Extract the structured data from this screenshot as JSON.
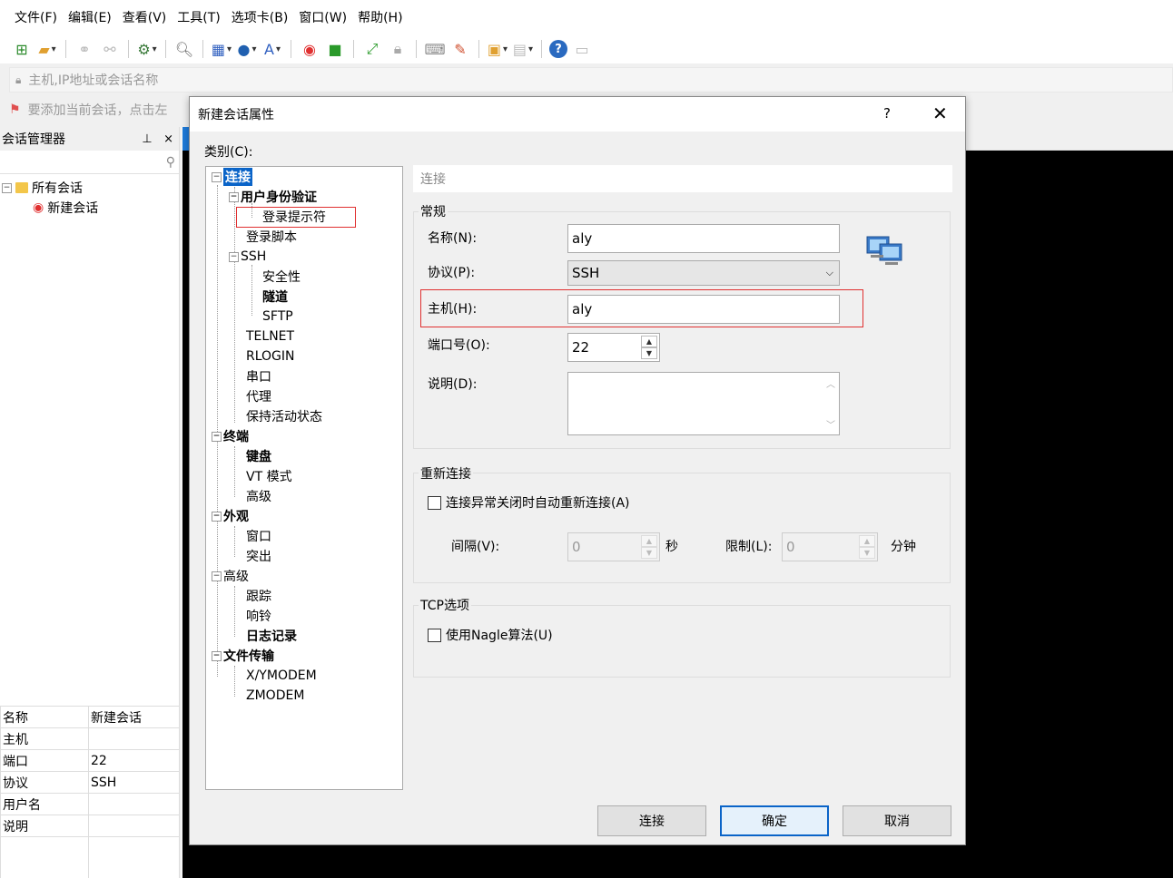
{
  "menu": [
    "文件(F)",
    "编辑(E)",
    "查看(V)",
    "工具(T)",
    "选项卡(B)",
    "窗口(W)",
    "帮助(H)"
  ],
  "address_placeholder": "主机,IP地址或会话名称",
  "hint_text": "要添加当前会话，点击左",
  "session_manager": {
    "title": "会话管理器",
    "pin": "ꟷ",
    "close": "×",
    "root": "所有会话",
    "child": "新建会话"
  },
  "props": [
    {
      "k": "名称",
      "v": "新建会话"
    },
    {
      "k": "主机",
      "v": ""
    },
    {
      "k": "端口",
      "v": "22"
    },
    {
      "k": "协议",
      "v": "SSH"
    },
    {
      "k": "用户名",
      "v": ""
    },
    {
      "k": "说明",
      "v": ""
    }
  ],
  "dialog": {
    "title": "新建会话属性",
    "help": "?",
    "close": "✕",
    "category_label": "类别(C):",
    "tree": {
      "conn": "连接",
      "auth": "用户身份验证",
      "login_prompt": "登录提示符",
      "login_script": "登录脚本",
      "ssh": "SSH",
      "security": "安全性",
      "tunnel": "隧道",
      "sftp": "SFTP",
      "telnet": "TELNET",
      "rlogin": "RLOGIN",
      "serial": "串口",
      "proxy": "代理",
      "keepalive": "保持活动状态",
      "terminal": "终端",
      "keyboard": "键盘",
      "vt": "VT 模式",
      "adv": "高级",
      "appearance": "外观",
      "window": "窗口",
      "highlight": "突出",
      "advanced": "高级",
      "trace": "跟踪",
      "bell": "响铃",
      "logging": "日志记录",
      "filetransfer": "文件传输",
      "xymodem": "X/YMODEM",
      "zmodem": "ZMODEM"
    },
    "section_head": "连接",
    "general": {
      "label": "常规",
      "name_label": "名称(N):",
      "name_value": "aly",
      "protocol_label": "协议(P):",
      "protocol_value": "SSH",
      "host_label": "主机(H):",
      "host_value": "aly",
      "port_label": "端口号(O):",
      "port_value": "22",
      "desc_label": "说明(D):"
    },
    "reconnect": {
      "label": "重新连接",
      "auto_label": "连接异常关闭时自动重新连接(A)",
      "interval_label": "间隔(V):",
      "interval_value": "0",
      "seconds": "秒",
      "limit_label": "限制(L):",
      "limit_value": "0",
      "minutes": "分钟"
    },
    "tcp": {
      "label": "TCP选项",
      "nagle_label": "使用Nagle算法(U)"
    },
    "buttons": {
      "connect": "连接",
      "ok": "确定",
      "cancel": "取消"
    }
  },
  "colors": {
    "selection": "#0a64c8",
    "highlight_box": "#e03030",
    "terminal": "#000000"
  }
}
